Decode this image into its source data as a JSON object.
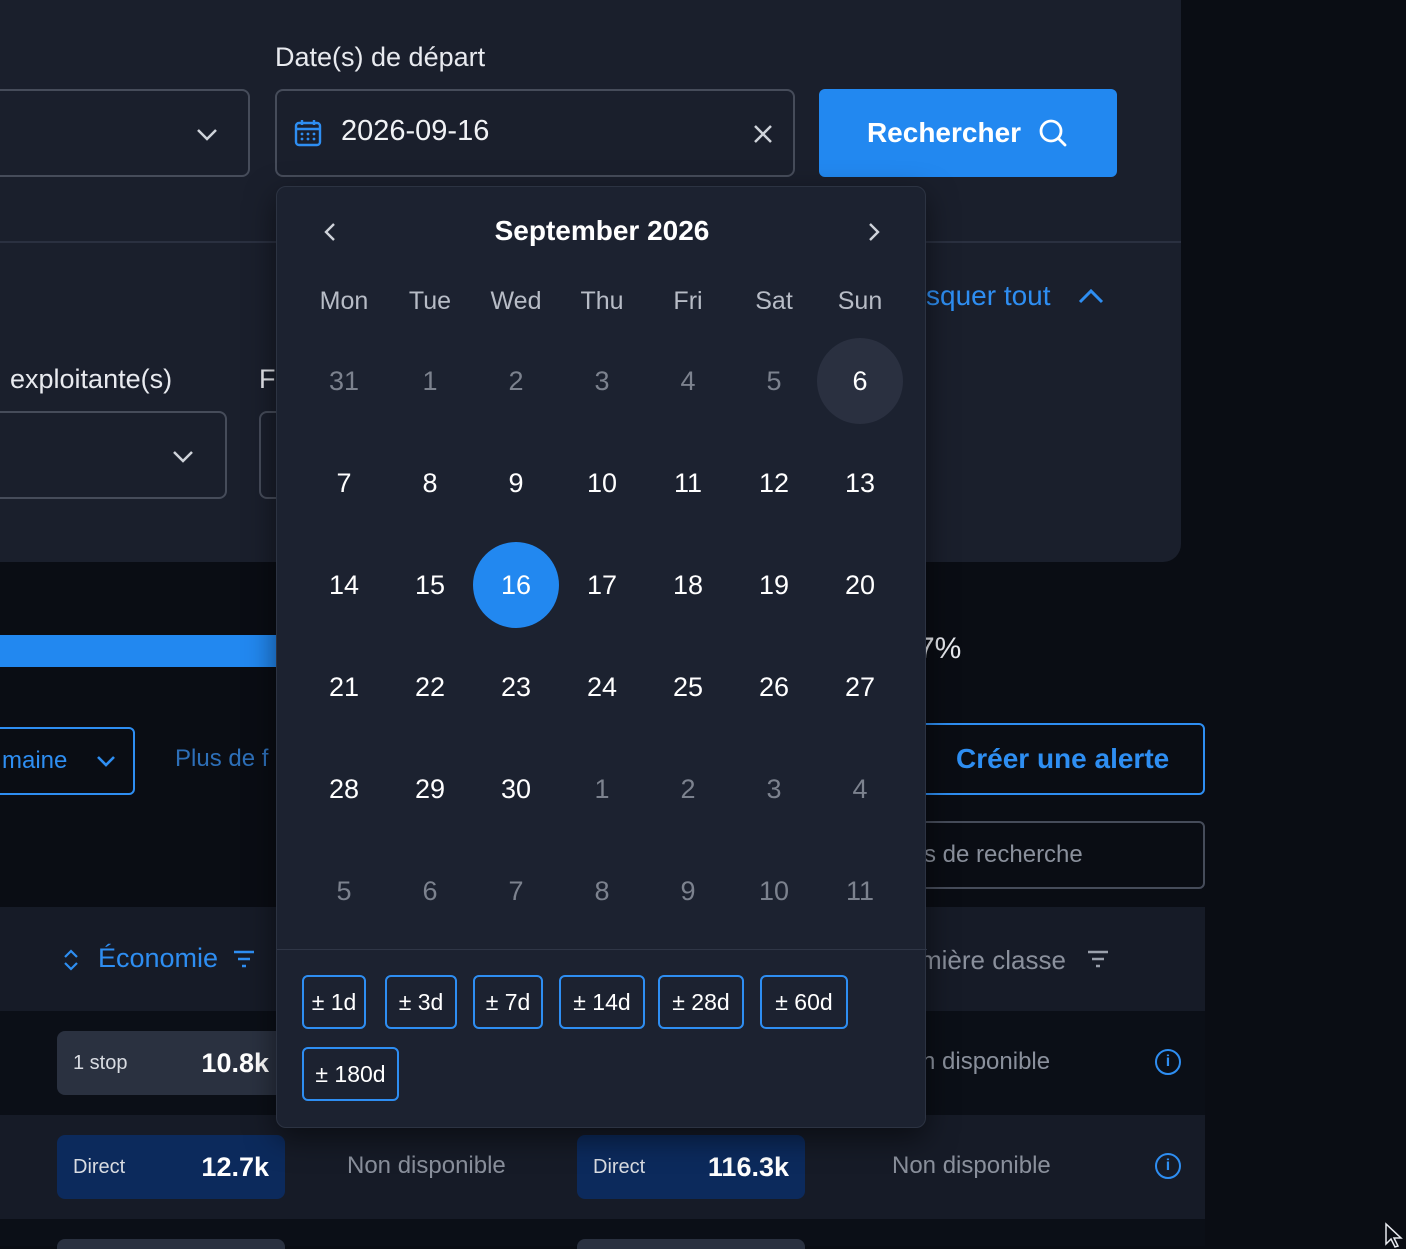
{
  "form": {
    "departure_label": "Date(s) de départ",
    "departure_value": "2026-09-16",
    "search_button": "Rechercher",
    "hide_all": "squer tout",
    "airline_label": "exploitante(s)",
    "other_label": "F"
  },
  "progress": {
    "percent_text": "7%"
  },
  "filters": {
    "week_dropdown": "maine",
    "more_filters": "Plus de f",
    "create_alert": "Créer une alerte",
    "search_placeholder": "s de recherche"
  },
  "table": {
    "col_economy": "Économie",
    "col_first": "mière classe",
    "rows": [
      {
        "chip1_label": "1 stop",
        "chip1_value": "10.8k",
        "first_value": "n disponible"
      },
      {
        "chip1_label": "Direct",
        "chip1_value": "12.7k",
        "na1": "Non disponible",
        "chip2_label": "Direct",
        "chip2_value": "116.3k",
        "na2": "Non disponible"
      }
    ]
  },
  "calendar": {
    "title": "September 2026",
    "weekdays": [
      "Mon",
      "Tue",
      "Wed",
      "Thu",
      "Fri",
      "Sat",
      "Sun"
    ],
    "weeks": [
      [
        "31",
        "1",
        "2",
        "3",
        "4",
        "5",
        "6"
      ],
      [
        "7",
        "8",
        "9",
        "10",
        "11",
        "12",
        "13"
      ],
      [
        "14",
        "15",
        "16",
        "17",
        "18",
        "19",
        "20"
      ],
      [
        "21",
        "22",
        "23",
        "24",
        "25",
        "26",
        "27"
      ],
      [
        "28",
        "29",
        "30",
        "1",
        "2",
        "3",
        "4"
      ],
      [
        "5",
        "6",
        "7",
        "8",
        "9",
        "10",
        "11"
      ]
    ],
    "muted": [
      [
        0,
        0
      ],
      [
        0,
        1
      ],
      [
        0,
        2
      ],
      [
        0,
        3
      ],
      [
        0,
        4
      ],
      [
        0,
        5
      ],
      [
        4,
        3
      ],
      [
        4,
        4
      ],
      [
        4,
        5
      ],
      [
        4,
        6
      ],
      [
        5,
        0
      ],
      [
        5,
        1
      ],
      [
        5,
        2
      ],
      [
        5,
        3
      ],
      [
        5,
        4
      ],
      [
        5,
        5
      ],
      [
        5,
        6
      ]
    ],
    "today": [
      0,
      6
    ],
    "selected": [
      2,
      2
    ],
    "ranges": [
      "± 1d",
      "± 3d",
      "± 7d",
      "± 14d",
      "± 28d",
      "± 60d",
      "± 180d"
    ]
  },
  "colors": {
    "accent": "#2288f0",
    "panel": "#1a1f2c",
    "background": "#0a0d14"
  }
}
